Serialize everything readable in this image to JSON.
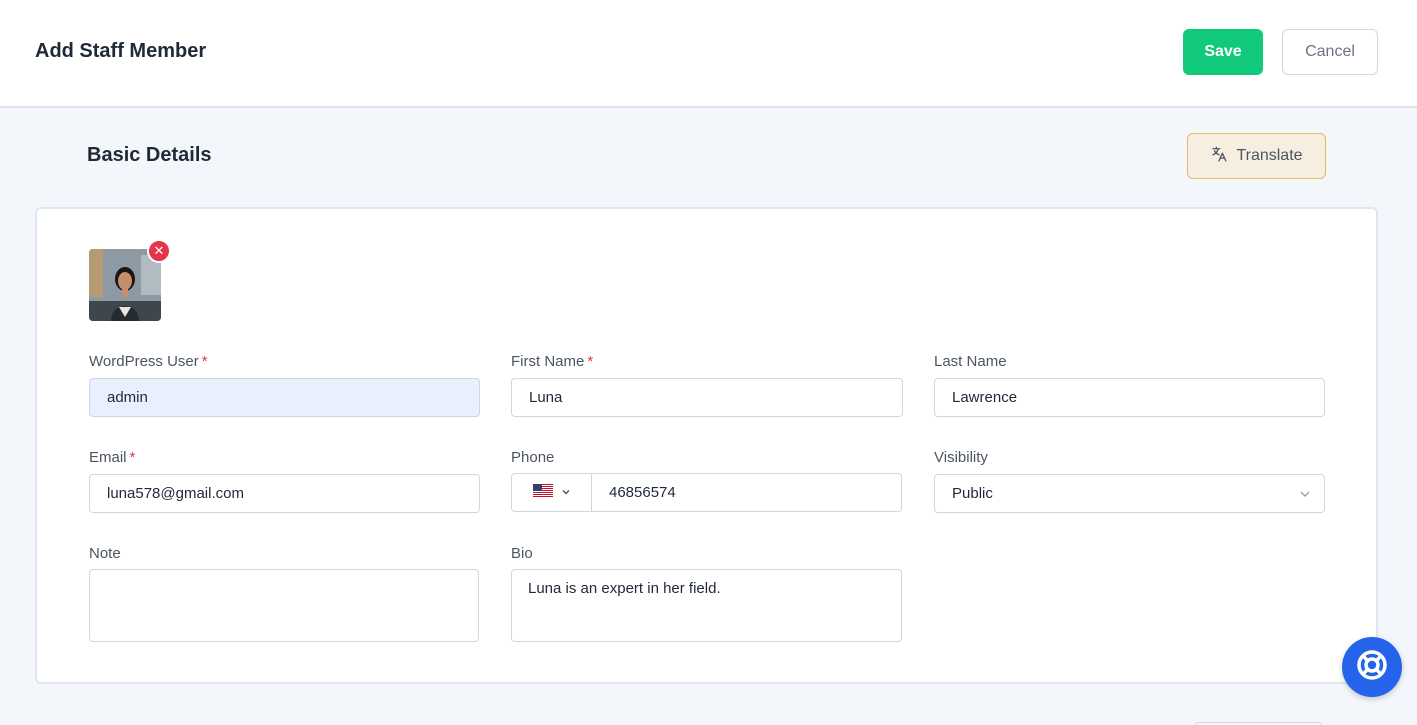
{
  "header": {
    "title": "Add Staff Member",
    "save_label": "Save",
    "cancel_label": "Cancel"
  },
  "section": {
    "title": "Basic Details",
    "translate_label": "Translate"
  },
  "form": {
    "wordpress_user": {
      "label": "WordPress User",
      "required": "*",
      "value": "admin"
    },
    "first_name": {
      "label": "First Name",
      "required": "*",
      "value": "Luna"
    },
    "last_name": {
      "label": "Last Name",
      "value": "Lawrence"
    },
    "email": {
      "label": "Email",
      "required": "*",
      "value": "luna578@gmail.com"
    },
    "phone": {
      "label": "Phone",
      "country_icon": "us-flag-icon",
      "value": "46856574"
    },
    "visibility": {
      "label": "Visibility",
      "value": "Public"
    },
    "note": {
      "label": "Note",
      "value": ""
    },
    "bio": {
      "label": "Bio",
      "value": "Luna is an expert in her field."
    }
  },
  "colors": {
    "accent_green": "#10c97a",
    "required_red": "#e6344a",
    "help_blue": "#2563eb"
  }
}
